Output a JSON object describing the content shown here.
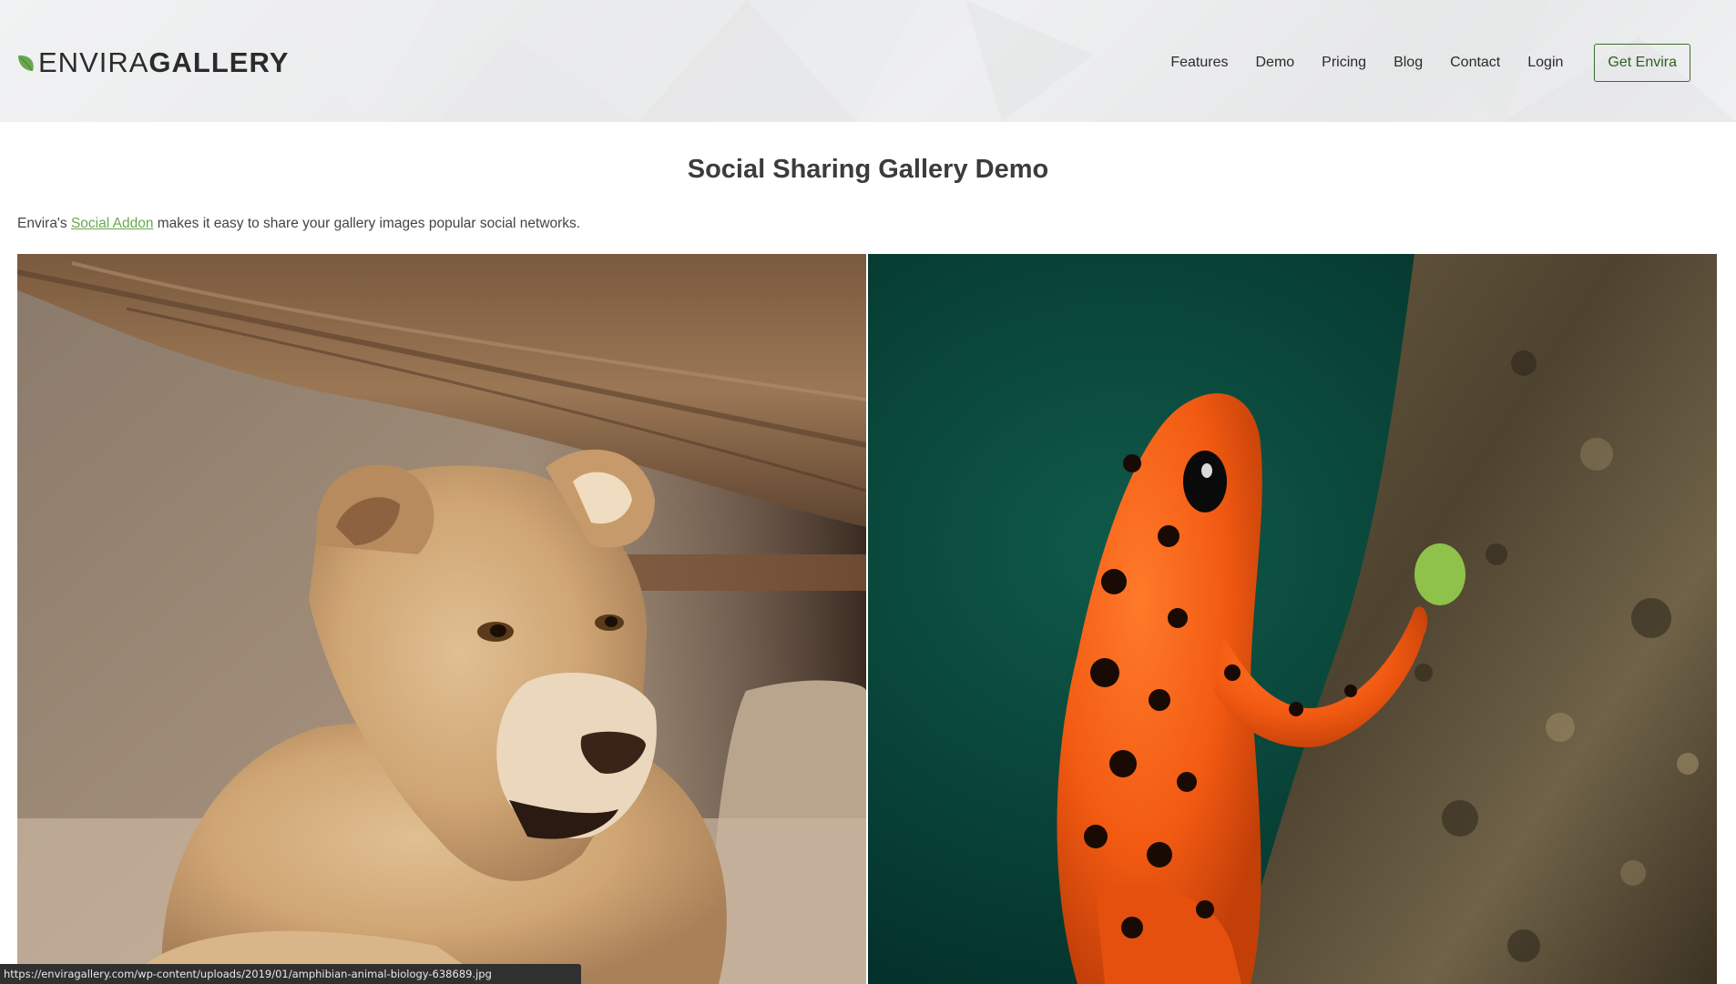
{
  "header": {
    "logo": {
      "light_text": "ENVIRA",
      "bold_text": "GALLERY",
      "icon": "leaf-icon"
    },
    "nav": [
      {
        "label": "Features"
      },
      {
        "label": "Demo"
      },
      {
        "label": "Pricing"
      },
      {
        "label": "Blog"
      },
      {
        "label": "Contact"
      },
      {
        "label": "Login"
      }
    ],
    "cta_label": "Get Envira"
  },
  "main": {
    "title": "Social Sharing Gallery Demo",
    "intro_prefix": "Envira's ",
    "intro_link": "Social Addon",
    "intro_suffix": " makes it easy to share your gallery images popular social networks."
  },
  "gallery": {
    "images": [
      {
        "subject": "lioness-photo"
      },
      {
        "subject": "red-frog-photo"
      }
    ]
  },
  "status_bar": {
    "url": "https://enviragallery.com/wp-content/uploads/2019/01/amphibian-animal-biology-638689.jpg"
  },
  "colors": {
    "brand_green": "#6aa84f",
    "cta_border": "#3c6e2d",
    "header_bg": "#ececed"
  }
}
